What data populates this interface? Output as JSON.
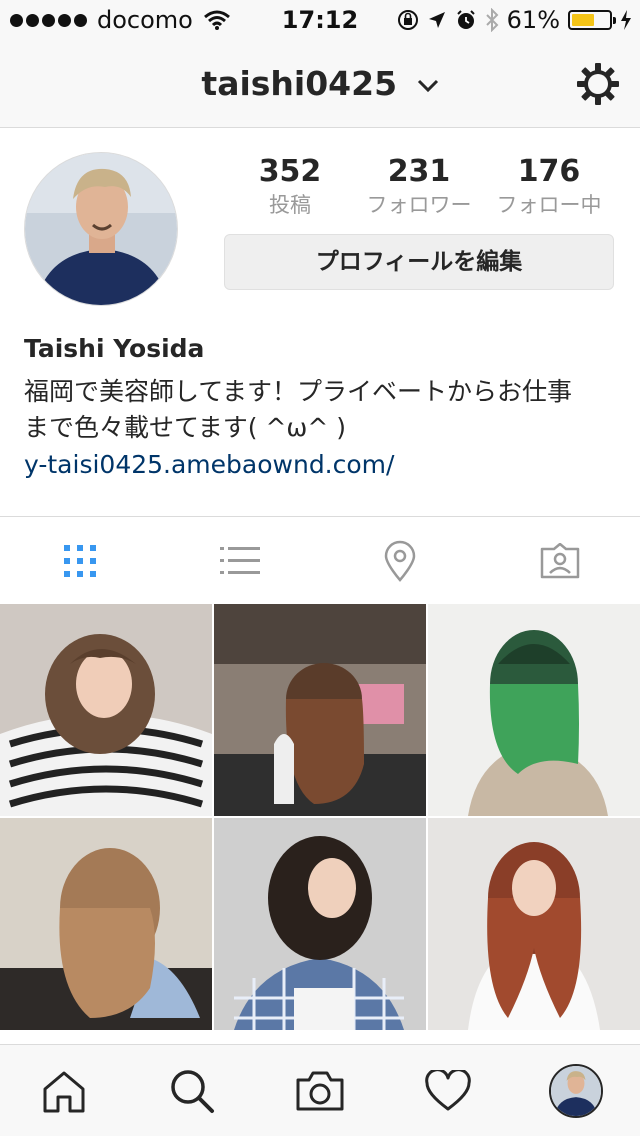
{
  "status_bar": {
    "carrier": "docomo",
    "time": "17:12",
    "battery": "61%",
    "battery_level": 0.61
  },
  "header": {
    "username": "taishi0425",
    "settings_icon": "gear-icon",
    "dropdown_icon": "chevron-down-icon"
  },
  "profile": {
    "stats": [
      {
        "value": "352",
        "label": "投稿"
      },
      {
        "value": "231",
        "label": "フォロワー"
      },
      {
        "value": "176",
        "label": "フォロー中"
      }
    ],
    "edit_button": "プロフィールを編集",
    "name": "Taishi Yosida",
    "bio_line1": "福岡で美容師してます！プライベートからお仕事",
    "bio_line2": "まで色々載せてます( ^ω^ )",
    "website": "y-taisi0425.amebaownd.com/"
  },
  "tabs": [
    {
      "icon": "grid-icon",
      "active": true
    },
    {
      "icon": "list-icon",
      "active": false
    },
    {
      "icon": "location-pin-icon",
      "active": false
    },
    {
      "icon": "tagged-photos-icon",
      "active": false
    }
  ],
  "bottom_nav": [
    {
      "icon": "home-icon"
    },
    {
      "icon": "search-icon"
    },
    {
      "icon": "camera-icon"
    },
    {
      "icon": "heart-icon"
    },
    {
      "icon": "profile-avatar-icon"
    }
  ],
  "colors": {
    "active_tab": "#3897f0",
    "inactive_icon": "#999999",
    "link": "#003569",
    "battery_fill": "#f5c518"
  }
}
